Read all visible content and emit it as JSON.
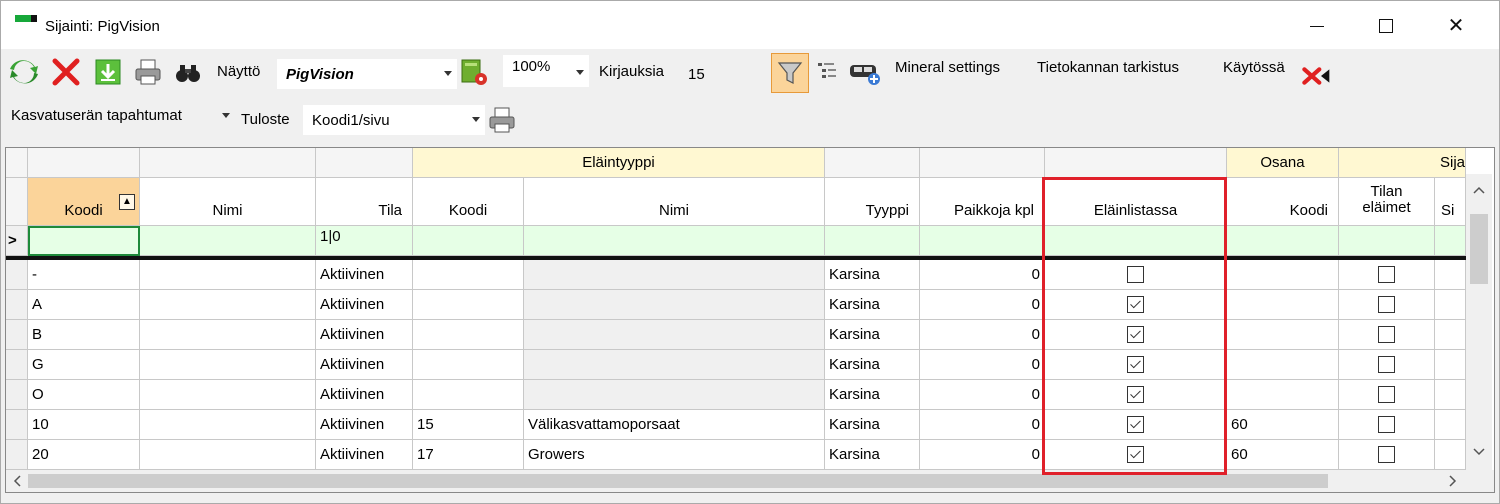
{
  "window": {
    "title": "Sijainti: PigVision",
    "minimize_glyph": "—",
    "close_glyph": "✕"
  },
  "toolbar": {
    "refresh_icon": "refresh-icon",
    "delete_icon": "red-x-icon",
    "download_icon": "download-icon",
    "print_icon": "printer-icon",
    "search_icon": "binoculars-icon",
    "naytto_label": "Näyttö",
    "naytto_value": "PigVision",
    "zoom_value": "100%",
    "kirjauksia_label": "Kirjauksia",
    "kirjauksia_value": "15",
    "mineral_settings": "Mineral settings",
    "tietokannan_tarkistus": "Tietokannan tarkistus",
    "kaytossa": "Käytössä"
  },
  "toolbar2": {
    "kasvatus_label": "Kasvatuserän tapahtumat",
    "tuloste_label": "Tuloste",
    "tuloste_value": "Koodi1/sivu"
  },
  "grid": {
    "band_elaintyyppi": "Eläintyyppi",
    "band_osana": "Osana",
    "band_sijainti_partial": "Sija",
    "headers": {
      "koodi": "Koodi",
      "nimi": "Nimi",
      "tila": "Tila",
      "et_koodi": "Koodi",
      "et_nimi": "Nimi",
      "tyyppi": "Tyyppi",
      "paikkoja": "Paikkoja kpl",
      "elainlistassa": "Eläinlistassa",
      "osana_koodi": "Koodi",
      "tilan_elaimet_1": "Tilan",
      "tilan_elaimet_2": "eläimet",
      "partial": "Si"
    },
    "sort_glyph": "▲",
    "current_row_marker": ">",
    "filter_tila": "1|0",
    "rows": [
      {
        "koodi": "-",
        "tila": "Aktiivinen",
        "et_koodi": "",
        "et_nimi": "",
        "tyyppi": "Karsina",
        "paikkoja": "0",
        "elainlistassa": false,
        "osana": "",
        "tilan_elaimet": false
      },
      {
        "koodi": "A",
        "tila": "Aktiivinen",
        "et_koodi": "",
        "et_nimi": "",
        "tyyppi": "Karsina",
        "paikkoja": "0",
        "elainlistassa": true,
        "osana": "",
        "tilan_elaimet": false
      },
      {
        "koodi": "B",
        "tila": "Aktiivinen",
        "et_koodi": "",
        "et_nimi": "",
        "tyyppi": "Karsina",
        "paikkoja": "0",
        "elainlistassa": true,
        "osana": "",
        "tilan_elaimet": false
      },
      {
        "koodi": "G",
        "tila": "Aktiivinen",
        "et_koodi": "",
        "et_nimi": "",
        "tyyppi": "Karsina",
        "paikkoja": "0",
        "elainlistassa": true,
        "osana": "",
        "tilan_elaimet": false
      },
      {
        "koodi": "O",
        "tila": "Aktiivinen",
        "et_koodi": "",
        "et_nimi": "",
        "tyyppi": "Karsina",
        "paikkoja": "0",
        "elainlistassa": true,
        "osana": "",
        "tilan_elaimet": false
      },
      {
        "koodi": "10",
        "tila": "Aktiivinen",
        "et_koodi": "15",
        "et_nimi": "Välikasvattamoporsaat",
        "tyyppi": "Karsina",
        "paikkoja": "0",
        "elainlistassa": true,
        "osana": "60",
        "tilan_elaimet": false
      },
      {
        "koodi": "20",
        "tila": "Aktiivinen",
        "et_koodi": "17",
        "et_nimi": "Growers",
        "tyyppi": "Karsina",
        "paikkoja": "0",
        "elainlistassa": true,
        "osana": "60",
        "tilan_elaimet": false
      }
    ]
  },
  "colors": {
    "highlight_box": "#e0202a",
    "filter_row": "#e6ffe6",
    "band": "#fff8d2",
    "filter_button": "#fbd49a"
  }
}
